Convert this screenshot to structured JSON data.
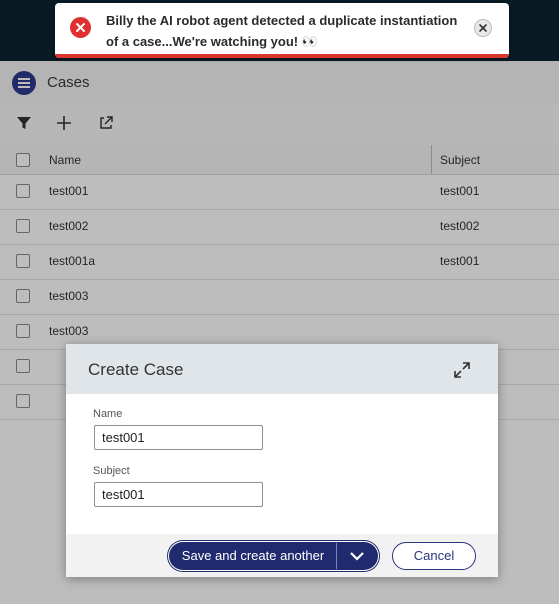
{
  "toast": {
    "message": "Billy the AI robot agent detected a duplicate instantiation of a case...We're watching you! 👀",
    "close_icon": "close-icon",
    "status_icon": "error-icon",
    "accent_color": "#e03131"
  },
  "app": {
    "title": "Cases",
    "toolbar": {
      "icons": [
        "filter-icon",
        "plus-icon",
        "open-external-icon"
      ]
    }
  },
  "table": {
    "columns": [
      "Name",
      "Subject"
    ],
    "rows": [
      {
        "name": "test001",
        "subject": "test001"
      },
      {
        "name": "test002",
        "subject": "test002"
      },
      {
        "name": "test001a",
        "subject": "test001"
      },
      {
        "name": "test003",
        "subject": ""
      },
      {
        "name": "test003",
        "subject": ""
      },
      {
        "name": "",
        "subject": ""
      },
      {
        "name": "",
        "subject": ""
      }
    ]
  },
  "modal": {
    "title": "Create Case",
    "fields": [
      {
        "label": "Name",
        "value": "test001"
      },
      {
        "label": "Subject",
        "value": "test001"
      }
    ],
    "save_label": "Save and create another",
    "cancel_label": "Cancel",
    "primary_color": "#1f2b6e"
  }
}
